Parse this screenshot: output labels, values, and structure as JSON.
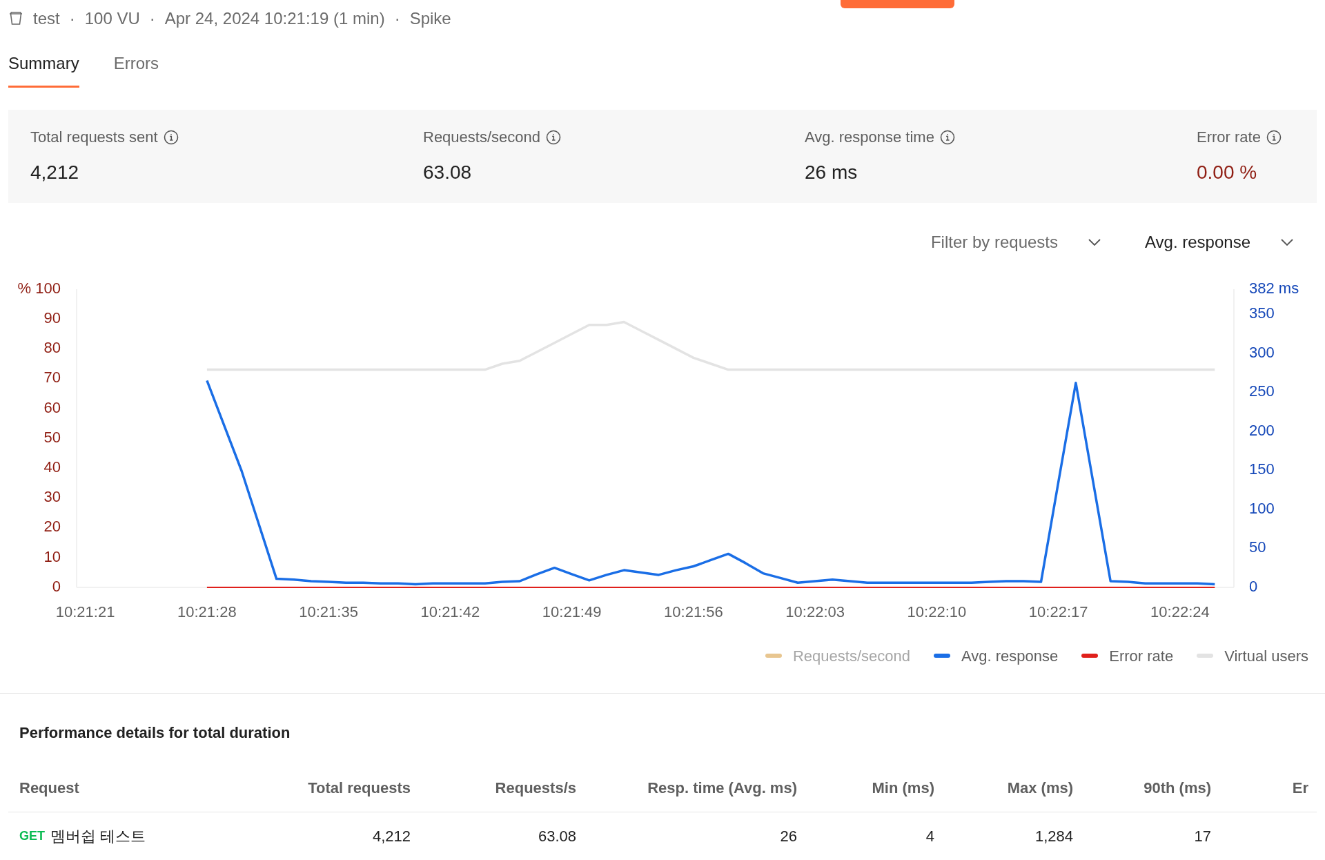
{
  "header": {
    "items": [
      "test",
      "·",
      "100 VU",
      "·",
      "Apr 24, 2024 10:21:19 (1 min)",
      "·",
      "Spike"
    ]
  },
  "tabs": [
    {
      "label": "Summary",
      "selected": true
    },
    {
      "label": "Errors",
      "selected": false
    }
  ],
  "stats": [
    {
      "label": "Total requests sent",
      "value": "4,212",
      "alert": false
    },
    {
      "label": "Requests/second",
      "value": "63.08",
      "alert": false
    },
    {
      "label": "Avg. response time",
      "value": "26 ms",
      "alert": false
    },
    {
      "label": "Error rate",
      "value": "0.00 %",
      "alert": true
    }
  ],
  "filters": [
    {
      "placeholder": "Filter by requests"
    },
    {
      "value": "Avg. response"
    }
  ],
  "chart": {
    "chart_data": {
      "type": "line",
      "categories": [
        "10:21:21",
        null,
        null,
        null,
        null,
        null,
        null,
        "10:21:28",
        null,
        null,
        null,
        null,
        null,
        null,
        "10:21:35",
        null,
        null,
        null,
        null,
        null,
        null,
        "10:21:42",
        null,
        null,
        null,
        null,
        null,
        null,
        "10:21:49",
        null,
        null,
        null,
        null,
        null,
        null,
        "10:21:56",
        null,
        null,
        null,
        null,
        null,
        null,
        "10:22:03",
        null,
        null,
        null,
        null,
        null,
        null,
        "10:22:10",
        null,
        null,
        null,
        null,
        null,
        null,
        "10:22:17",
        null,
        null,
        null,
        null,
        null,
        null,
        "10:22:24",
        null,
        null
      ],
      "ylim": [
        0,
        100
      ],
      "yticks": [
        0,
        10,
        20,
        30,
        40,
        50,
        60,
        70,
        80,
        90,
        {
          "value": 100,
          "label": "% 100"
        }
      ],
      "y2lim": [
        0,
        382
      ],
      "y2ticks": [
        0,
        50,
        100,
        150,
        200,
        250,
        300,
        350,
        {
          "value": 382,
          "label": "382 ms"
        }
      ],
      "series": [
        {
          "name": "Requests/second",
          "color": "#e8c690",
          "values": [
            null,
            null,
            null,
            null,
            null,
            null,
            null,
            null,
            null,
            null,
            null,
            null,
            null,
            null,
            null,
            null,
            null,
            null,
            null,
            null,
            null,
            null,
            null,
            null,
            null,
            null,
            null,
            null,
            null,
            null,
            null,
            null,
            null,
            null,
            null,
            null,
            null,
            null,
            null,
            null,
            null,
            null,
            null,
            null,
            null,
            null,
            null,
            null,
            null,
            null,
            null,
            null,
            null,
            null,
            null,
            null,
            null,
            null,
            null,
            null,
            null,
            null,
            null,
            null,
            null,
            null
          ]
        },
        {
          "name": "Avg. response",
          "color": "#1a6ee6",
          "axis": "y2",
          "values": [
            null,
            null,
            null,
            null,
            null,
            null,
            null,
            265,
            207,
            149,
            80,
            11,
            10,
            8,
            7,
            6,
            6,
            5,
            5,
            4,
            5,
            5,
            5,
            5,
            7,
            8,
            17,
            25,
            17,
            9,
            16,
            22,
            19,
            16,
            22,
            27,
            35,
            43,
            31,
            18,
            12,
            6,
            8,
            10,
            8,
            6,
            6,
            6,
            6,
            6,
            6,
            6,
            7,
            8,
            8,
            7,
            135,
            262,
            135,
            8,
            7,
            5,
            5,
            5,
            5,
            4
          ]
        },
        {
          "name": "Error rate",
          "color": "#e0201b",
          "values": [
            null,
            null,
            null,
            null,
            null,
            null,
            null,
            0,
            0,
            0,
            0,
            0,
            0,
            0,
            0,
            0,
            0,
            0,
            0,
            0,
            0,
            0,
            0,
            0,
            0,
            0,
            0,
            0,
            0,
            0,
            0,
            0,
            0,
            0,
            0,
            0,
            0,
            0,
            0,
            0,
            0,
            0,
            0,
            0,
            0,
            0,
            0,
            0,
            0,
            0,
            0,
            0,
            0,
            0,
            0,
            0,
            0,
            0,
            0,
            0,
            0,
            0,
            0,
            0,
            0,
            0
          ]
        },
        {
          "name": "Virtual users",
          "color": "#e3e3e3",
          "values": [
            null,
            null,
            null,
            null,
            null,
            null,
            null,
            73,
            73,
            73,
            73,
            73,
            73,
            73,
            73,
            73,
            73,
            73,
            73,
            73,
            73,
            73,
            73,
            73,
            75,
            76,
            79,
            82,
            85,
            88,
            88,
            89,
            86,
            83,
            80,
            77,
            75,
            73,
            73,
            73,
            73,
            73,
            73,
            73,
            73,
            73,
            73,
            73,
            73,
            73,
            73,
            73,
            73,
            73,
            73,
            73,
            73,
            73,
            73,
            73,
            73,
            73,
            73,
            73,
            73,
            73
          ]
        }
      ]
    }
  },
  "performance": {
    "title": "Performance details for total duration",
    "columns": [
      "Request",
      "Total requests",
      "Requests/s",
      "Resp. time (Avg. ms)",
      "Min (ms)",
      "Max (ms)",
      "90th (ms)",
      "Er"
    ],
    "rows": [
      {
        "method": "GET",
        "cells": [
          "멤버쉽 테스트",
          "4,212",
          "63.08",
          "26",
          "4",
          "1,284",
          "17"
        ]
      }
    ]
  }
}
